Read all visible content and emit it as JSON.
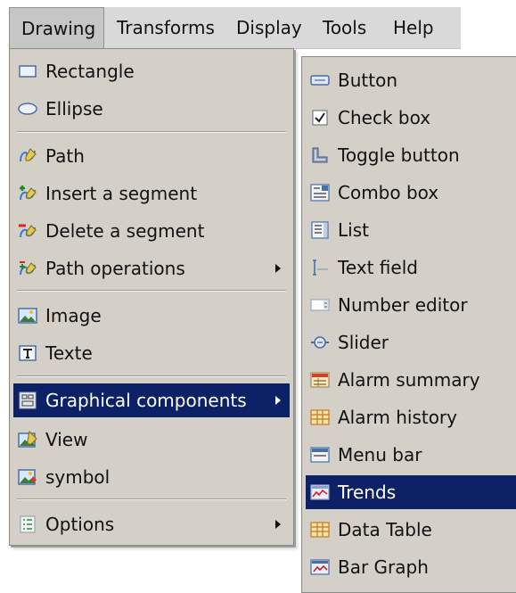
{
  "menubar": {
    "items": [
      {
        "label": "Drawing"
      },
      {
        "label": "Transforms"
      },
      {
        "label": "Display"
      },
      {
        "label": "Tools"
      },
      {
        "label": "Help"
      }
    ]
  },
  "drawing_menu": {
    "items": [
      {
        "label": "Rectangle",
        "icon": "rectangle-icon"
      },
      {
        "label": "Ellipse",
        "icon": "ellipse-icon"
      },
      {
        "label": "Path",
        "icon": "path-icon"
      },
      {
        "label": "Insert a segment",
        "icon": "insert-segment-icon"
      },
      {
        "label": "Delete a segment",
        "icon": "delete-segment-icon"
      },
      {
        "label": "Path operations",
        "icon": "path-operations-icon",
        "submenu": true
      },
      {
        "label": "Image",
        "icon": "image-icon"
      },
      {
        "label": "Texte",
        "icon": "text-icon"
      },
      {
        "label": "Graphical components",
        "icon": "graphical-components-icon",
        "submenu": true,
        "selected": true
      },
      {
        "label": "View",
        "icon": "view-icon"
      },
      {
        "label": "symbol",
        "icon": "symbol-icon"
      },
      {
        "label": "Options",
        "icon": "options-icon",
        "submenu": true
      }
    ]
  },
  "components_submenu": {
    "items": [
      {
        "label": "Button",
        "icon": "button-icon"
      },
      {
        "label": "Check box",
        "icon": "checkbox-icon"
      },
      {
        "label": "Toggle button",
        "icon": "toggle-button-icon"
      },
      {
        "label": "Combo box",
        "icon": "combo-box-icon"
      },
      {
        "label": "List",
        "icon": "list-icon"
      },
      {
        "label": "Text field",
        "icon": "text-field-icon"
      },
      {
        "label": "Number editor",
        "icon": "number-editor-icon"
      },
      {
        "label": "Slider",
        "icon": "slider-icon"
      },
      {
        "label": "Alarm summary",
        "icon": "alarm-summary-icon"
      },
      {
        "label": "Alarm history",
        "icon": "alarm-history-icon"
      },
      {
        "label": "Menu bar",
        "icon": "menu-bar-icon"
      },
      {
        "label": "Trends",
        "icon": "trends-icon",
        "selected": true
      },
      {
        "label": "Data Table",
        "icon": "data-table-icon"
      },
      {
        "label": "Bar Graph",
        "icon": "bar-graph-icon"
      }
    ]
  },
  "colors": {
    "selection": "#0d2167",
    "menu_bg": "#d4d0c8",
    "menubar_bg": "#d9d9d9"
  }
}
